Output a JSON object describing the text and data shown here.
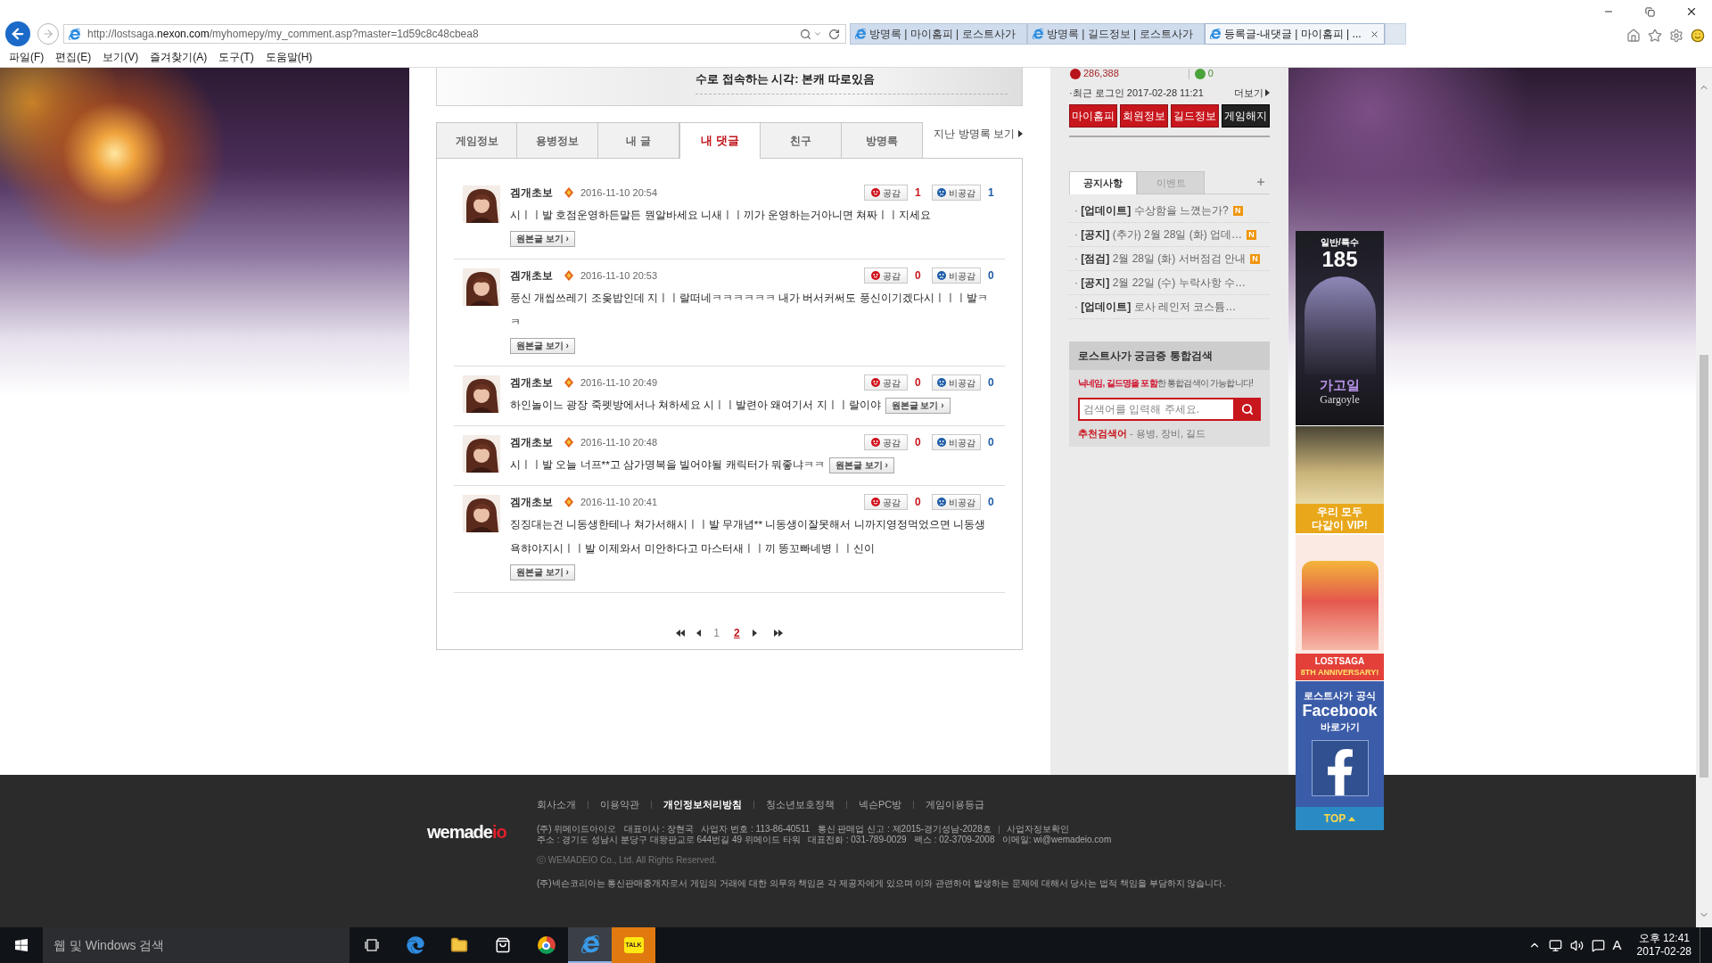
{
  "browser": {
    "address": "http://lostsaga.**nexon.com**/myhomepy/my_comment.asp?master=1d59c8c48cbea8",
    "tabs": [
      {
        "title": "방명록 | 마이홈피 | 로스트사가",
        "selected": false
      },
      {
        "title": "방명록 | 길드정보 | 로스트사가",
        "selected": false
      },
      {
        "title": "등록글-내댓글 | 마이홈피 | ...",
        "selected": true
      }
    ],
    "menu": [
      "파일(F)",
      "편집(E)",
      "보기(V)",
      "즐겨찾기(A)",
      "도구(T)",
      "도움말(H)"
    ]
  },
  "profile": {
    "status": "수로 접속하는 시각: 본캐 따로있음",
    "tabs": [
      {
        "label": "게임정보",
        "selected": false
      },
      {
        "label": "용병정보",
        "selected": false
      },
      {
        "label": "내 글",
        "selected": false
      },
      {
        "label": "내 댓글",
        "selected": true
      },
      {
        "label": "친구",
        "selected": false
      },
      {
        "label": "방명록",
        "selected": false
      }
    ],
    "past_link": "지난 방명록 보기"
  },
  "comments": [
    {
      "author": "겜개초보",
      "date": "2016-11-10 20:54",
      "like_label": "공감",
      "likes": "1",
      "dislike_label": "비공감",
      "dislikes": "1",
      "text": "시ㅣㅣ발 호점운영하든말든 뭔알바세요 니새ㅣㅣ끼가 운영하는거아니면 쳐짜ㅣㅣ지세요",
      "button": "원본글 보기 ›"
    },
    {
      "author": "겜개초보",
      "date": "2016-11-10 20:53",
      "like_label": "공감",
      "likes": "0",
      "dislike_label": "비공감",
      "dislikes": "0",
      "text": "풍신 개씹쓰레기 조옺밥인데 지ㅣㅣ랄떠네ㅋㅋㅋㅋㅋㅋ 내가 버서커써도 풍신이기겠다시ㅣㅣㅣ발ㅋㅋ",
      "button": "원본글 보기 ›"
    },
    {
      "author": "겜개초보",
      "date": "2016-11-10 20:49",
      "like_label": "공감",
      "likes": "0",
      "dislike_label": "비공감",
      "dislikes": "0",
      "text": "하인놀이느 광장 죽펫방에서나 쳐하세요 시ㅣㅣ발련아 왜여기서 지ㅣㅣ랄이야",
      "button": "원본글 보기 ›"
    },
    {
      "author": "겜개초보",
      "date": "2016-11-10 20:48",
      "like_label": "공감",
      "likes": "0",
      "dislike_label": "비공감",
      "dislikes": "0",
      "text": "시ㅣㅣ발 오늘 너프**고 삼가명복을 빌어야될 캐릭터가 뭐좋냐ㅋㅋ",
      "button": "원본글 보기 ›"
    },
    {
      "author": "겜개초보",
      "date": "2016-11-10 20:41",
      "like_label": "공감",
      "likes": "0",
      "dislike_label": "비공감",
      "dislikes": "0",
      "text": "징징대는건 니동생한테나 쳐가서해시ㅣㅣ발 무개념** 니동생이잘못해서 니까지영정먹었으면 니동생 욕햐야지시ㅣㅣ발 이제와서 미안하다고 마스터새ㅣㅣ끼 똥꼬빠네병ㅣㅣ신이",
      "button": "원본글 보기 ›"
    }
  ],
  "pagination": [
    {
      "label": "1",
      "selected": false
    },
    {
      "label": "2",
      "selected": true
    }
  ],
  "sidebar": {
    "points": "286,388",
    "mileage": "0",
    "last_login": "·최근 로그인 2017-02-28 11:21",
    "more": "더보기",
    "buttons": [
      {
        "label": "마이홈피",
        "kind": "red"
      },
      {
        "label": "회원정보",
        "kind": "red"
      },
      {
        "label": "길드정보",
        "kind": "red"
      },
      {
        "label": "게임해지",
        "kind": "dark"
      }
    ],
    "notice_tabs": [
      {
        "label": "공지사항",
        "selected": true
      },
      {
        "label": "이벤트",
        "selected": false
      }
    ],
    "notices": [
      {
        "text": "· **[업데이트]** 수상함을 느꼈는가?",
        "badge": "N"
      },
      {
        "text": "· **[공지]** (추가) 2월 28일 (화) 업데…",
        "badge": "N"
      },
      {
        "text": "· **[점검]** 2월 28일 (화) 서버점검 안내",
        "badge": "N"
      },
      {
        "text": "· **[공지]** 2월 22일 (수) 누락사항 수…"
      },
      {
        "text": "· **[업데이트]** 로사 레인저 코스튬…"
      }
    ],
    "search": {
      "title": "로스트사가 궁금증 통합검색",
      "hint": "**닉네임, 길드명을 포함**한 통합검색이 가능합니다!",
      "placeholder": "검색어를 입력해 주세요.",
      "recommended": "**추천검색어** - 용병, 장비, 길드"
    }
  },
  "banners": [
    {
      "kind": "character",
      "caption": "일반/특수",
      "number": "185",
      "name": "가고일",
      "name_en": "Gargoyle"
    },
    {
      "kind": "vip",
      "lines": [
        "우리 모두",
        "다같이 VIP!"
      ]
    },
    {
      "kind": "anniversary",
      "lines": [
        "LOSTSAGA",
        "8TH ANNIVERSARY!"
      ]
    },
    {
      "kind": "facebook",
      "lines": [
        "로스트사가 공식",
        "Facebook",
        "바로가기"
      ]
    },
    {
      "kind": "top",
      "label": "TOP"
    }
  ],
  "footer": {
    "links": [
      {
        "label": "회사소개",
        "highlight": false
      },
      {
        "label": "이용약관",
        "highlight": false
      },
      {
        "label": "개인정보처리방침",
        "highlight": true
      },
      {
        "label": "청소년보호정책",
        "highlight": false
      },
      {
        "label": "넥슨PC방",
        "highlight": false
      },
      {
        "label": "게임이용등급",
        "highlight": false
      }
    ],
    "logo": {
      "text": "wemade",
      "accent": "io"
    },
    "info": [
      "(주) 위메이드아이오   대표이사 : 장현국   사업자 번호 : 113-86-40511   통신 판매업 신고 : 제2015-경기성남-2028호",
      "주소 : 경기도 성남시 분당구 대왕판교로 644번길 49 위메이드 타워   대표전화 : 031-789-0029   팩스 : 02-3709-2008   이메일: wi@wemadeio.com"
    ],
    "info_link": "사업자정보확인",
    "copyright": "ⓒ WEMADEIO Co., Ltd. All Rights Reserved.",
    "disclaimer": "(주)넥슨코리아는 통신판매중개자로서 게임의 거래에 대한 의무와 책임은 각 제공자에게 있으며 이와 관련하여 발생하는 문제에 대해서 당사는 법적 책임을 부담하지 않습니다."
  },
  "taskbar": {
    "search_placeholder": "웹 및 Windows 검색",
    "apps": [
      {
        "kind": "task-view",
        "active": false,
        "flashing": false
      },
      {
        "kind": "edge",
        "active": false,
        "flashing": false
      },
      {
        "kind": "explorer",
        "active": false,
        "flashing": false
      },
      {
        "kind": "store",
        "active": false,
        "flashing": false
      },
      {
        "kind": "chrome",
        "active": false,
        "flashing": false
      },
      {
        "kind": "ie",
        "active": true,
        "flashing": false
      },
      {
        "kind": "chat",
        "label": "TALK",
        "active": false,
        "flashing": true
      }
    ],
    "ime": "A",
    "time": "오후 12:41",
    "date": "2017-02-28"
  }
}
